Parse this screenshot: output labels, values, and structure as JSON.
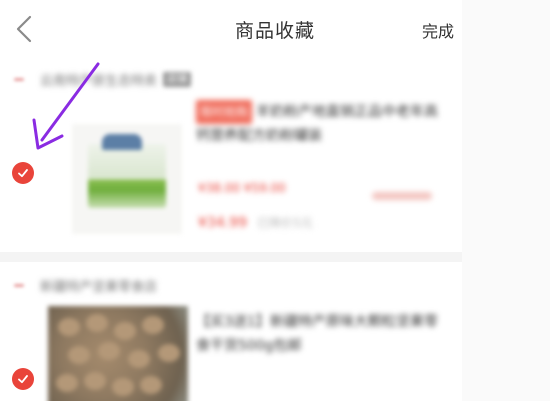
{
  "header": {
    "title": "商品收藏",
    "done_label": "完成",
    "back_icon": "chevron-left-icon"
  },
  "colors": {
    "accent_red": "#e9443a",
    "annotation_purple": "#8a2be2"
  },
  "favorites": [
    {
      "store_name": "云南特产原生态特卖",
      "store_tag": "店铺",
      "title_tag": "限时抢购",
      "title": "羊奶粉产地直销正品中老年高钙营养配方奶粉罐装",
      "price_line": "¥38.00  ¥59.00",
      "price": "¥34.99",
      "price_sub": "已降价5元",
      "selected": true
    },
    {
      "store_name": "新疆特产坚果零食店",
      "title": "【买3送1】新疆特产原味大颗粒坚果零食干货500g包邮",
      "selected": true
    }
  ]
}
